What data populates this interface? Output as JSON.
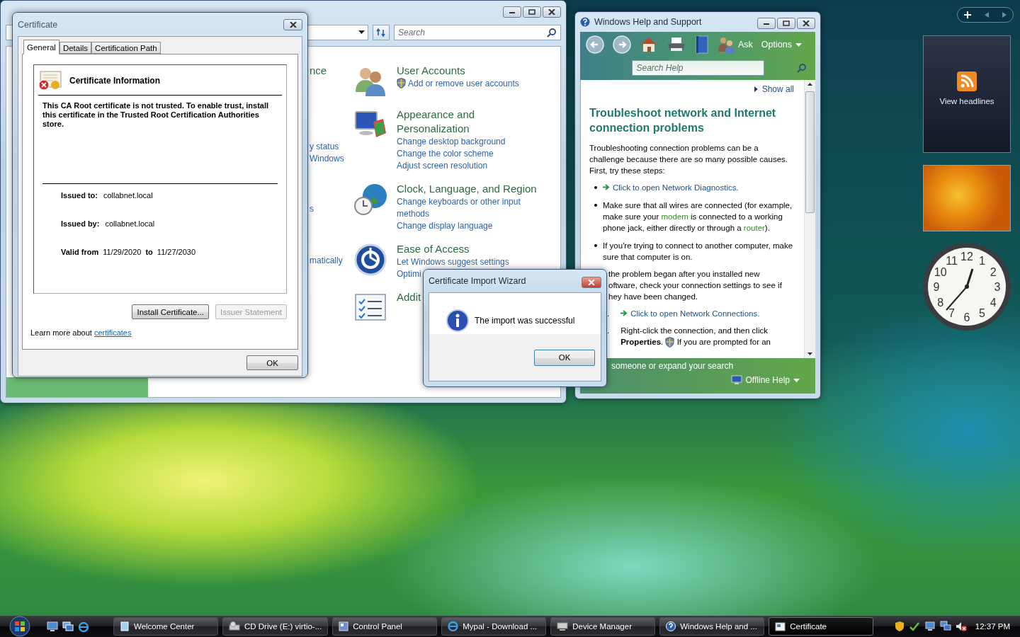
{
  "control_panel": {
    "search": {
      "placeholder": "Search"
    },
    "left_fragments": [
      {
        "kind": "title",
        "text": "nce"
      },
      {
        "kind": "link",
        "text": "y status"
      },
      {
        "kind": "link",
        "text": "Windows"
      },
      {
        "kind": "link",
        "text": "s"
      },
      {
        "kind": "link",
        "text": "matically"
      }
    ],
    "categories": [
      {
        "title": "User Accounts",
        "kind": "users",
        "links": [
          {
            "text": "Add or remove user accounts",
            "shield": true
          }
        ]
      },
      {
        "title": "Appearance and Personalization",
        "kind": "appearance",
        "links": [
          {
            "text": "Change desktop background",
            "shield": false
          },
          {
            "text": "Change the color scheme",
            "shield": false
          },
          {
            "text": "Adjust screen resolution",
            "shield": false
          }
        ]
      },
      {
        "title": "Clock, Language, and Region",
        "kind": "clock",
        "links": [
          {
            "text": "Change keyboards or other input methods",
            "shield": false
          },
          {
            "text": "Change display language",
            "shield": false
          }
        ]
      },
      {
        "title": "Ease of Access",
        "kind": "access",
        "links": [
          {
            "text": "Let Windows suggest settings",
            "shield": false
          },
          {
            "text": "Optimi",
            "shield": false
          }
        ]
      },
      {
        "title": "Addit",
        "kind": "programs"
      }
    ]
  },
  "certificate": {
    "title": "Certificate",
    "tabs": [
      {
        "label": "General",
        "selected": true
      },
      {
        "label": "Details",
        "selected": false
      },
      {
        "label": "Certification Path",
        "selected": false
      }
    ],
    "info_title": "Certificate Information",
    "message": "This CA Root certificate is not trusted. To enable trust, install this certificate in the Trusted Root Certification Authorities store.",
    "fields": [
      {
        "label": "Issued to:",
        "value": "collabnet.local"
      },
      {
        "label": "Issued by:",
        "value": "collabnet.local"
      }
    ],
    "validity": {
      "label": "Valid from",
      "from": "11/29/2020",
      "separator": "to",
      "to": "11/27/2030"
    },
    "buttons": [
      {
        "label": "Install Certificate...",
        "disabled": false
      },
      {
        "label": "Issuer Statement",
        "disabled": true
      }
    ],
    "learn_more": {
      "text": "Learn more about",
      "link": "certificates"
    },
    "ok": "OK"
  },
  "wizard": {
    "title": "Certificate Import Wizard",
    "message": "The import was successful",
    "ok": "OK"
  },
  "help": {
    "title": "Windows Help and Support",
    "toolbar": {
      "ask": "Ask",
      "options": "Options"
    },
    "search": {
      "placeholder": "Search Help"
    },
    "show_all": "Show all",
    "heading": "Troubleshoot network and Internet connection problems",
    "intro": "Troubleshooting connection problems can be a challenge because there are so many possible causes. First, try these steps:",
    "items": [
      {
        "kind": "bullet",
        "action": true,
        "parts": [
          {
            "kind": "plain",
            "text": "Click to open Network Diagnostics."
          }
        ]
      },
      {
        "kind": "bullet",
        "action": false,
        "parts": [
          {
            "kind": "plain",
            "text": "Make sure that all wires are connected (for example, make sure your "
          },
          {
            "kind": "term",
            "text": "modem"
          },
          {
            "kind": "plain",
            "text": " is connected to a working phone jack, either directly or through a "
          },
          {
            "kind": "term",
            "text": "router"
          },
          {
            "kind": "plain",
            "text": ")."
          }
        ]
      },
      {
        "kind": "bullet",
        "action": false,
        "parts": [
          {
            "kind": "plain",
            "text": "If you're trying to connect to another computer, make sure that computer is on."
          }
        ]
      },
      {
        "kind": "cut",
        "lines": [
          "the problem began after you installed new",
          "oftware, check your connection settings to see if",
          "hey have been changed."
        ]
      },
      {
        "kind": "step",
        "marker": ".",
        "action": true,
        "parts": [
          {
            "kind": "plain",
            "text": "Click to open Network Connections."
          }
        ]
      },
      {
        "kind": "step",
        "marker": ".",
        "action": false,
        "parts": [
          {
            "kind": "plain",
            "text": "Right-click the connection, and then click "
          },
          {
            "kind": "bold",
            "text": "Properties"
          },
          {
            "kind": "plain",
            "text": ". "
          },
          {
            "kind": "shield"
          },
          {
            "kind": "plain",
            "text": " If you are prompted for an"
          }
        ]
      }
    ],
    "footer": {
      "text": "someone or expand your search",
      "offline": "Offline Help"
    }
  },
  "sidebar": {
    "feed": {
      "label": "View headlines"
    },
    "clock": {
      "numerals": [
        "11",
        "12",
        "1",
        "10",
        "2",
        "9",
        "3",
        "8",
        "4",
        "7",
        "6",
        "5"
      ]
    }
  },
  "taskbar": {
    "tasks": [
      {
        "label": "Welcome Center",
        "kind": "window",
        "selected": false
      },
      {
        "label": "CD Drive (E:) virtio-...",
        "kind": "drive",
        "selected": false
      },
      {
        "label": "Control Panel",
        "kind": "panel",
        "selected": false
      },
      {
        "label": "Mypal - Download ...",
        "kind": "browser",
        "selected": false
      },
      {
        "label": "Device Manager",
        "kind": "device",
        "selected": false
      },
      {
        "label": "Windows Help and ...",
        "kind": "help",
        "selected": false
      },
      {
        "label": "Certificate",
        "kind": "cert",
        "selected": true
      }
    ],
    "time": "12:37 PM"
  }
}
